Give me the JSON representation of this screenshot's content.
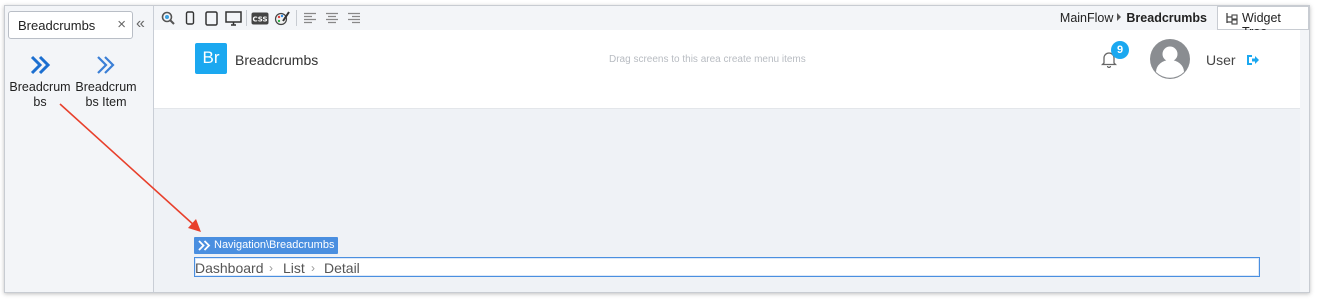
{
  "toolbox": {
    "search_value": "Breadcrumbs",
    "clear_glyph": "×",
    "collapse_glyph": "«",
    "items": [
      {
        "label": "Breadcrumbs",
        "icon": "double-chevron-right-icon"
      },
      {
        "label": "Breadcrumbs Item",
        "icon": "double-chevron-right-icon"
      }
    ]
  },
  "toolbar": {
    "icons": [
      "preview-icon",
      "mobile-icon",
      "tablet-icon",
      "desktop-icon",
      "css-icon",
      "theme-icon",
      "align-left-icon",
      "align-center-icon",
      "align-right-icon"
    ],
    "flow": "MainFlow",
    "screen": "Breadcrumbs",
    "widget_tree_label": "Widget Tree"
  },
  "app": {
    "logo_text": "Br",
    "title": "Breadcrumbs",
    "menu_hint": "Drag screens to this area create menu items",
    "notification_count": "9",
    "user_name": "User",
    "accent": "#1ba8f0"
  },
  "breadcrumbs_widget": {
    "tag": "Navigation\\Breadcrumbs",
    "items": [
      "Dashboard",
      "List",
      "Detail"
    ],
    "separator": "›",
    "selection_color": "#4a8fe0"
  },
  "annotation": {
    "arrow_color": "#e8402c"
  }
}
